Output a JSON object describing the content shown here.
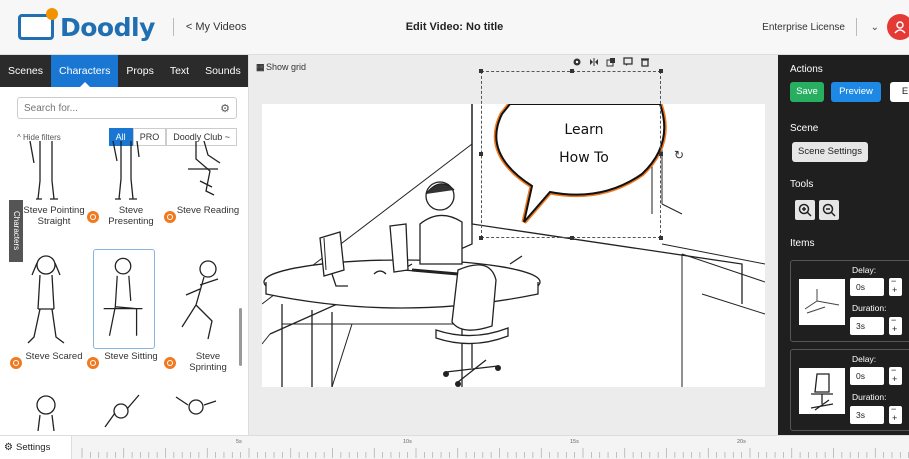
{
  "header": {
    "brand": "Doodly",
    "back_link": "< My Videos",
    "title": "Edit Video: No title",
    "license": "Enterprise License"
  },
  "left_panel": {
    "tabs": [
      "Scenes",
      "Characters",
      "Props",
      "Text",
      "Sounds"
    ],
    "active_tab": "Characters",
    "search_placeholder": "Search for...",
    "hide_filters": "^ Hide filters",
    "filters": [
      "All",
      "PRO",
      "Doodly Club ~"
    ],
    "active_filter": "All",
    "vertical_tab": "Characters",
    "characters": [
      {
        "name": "Steve Pointing Straight"
      },
      {
        "name": "Steve Presenting"
      },
      {
        "name": "Steve Reading"
      },
      {
        "name": "Steve Scared"
      },
      {
        "name": "Steve Sitting"
      },
      {
        "name": "Steve Sprinting"
      }
    ]
  },
  "canvas": {
    "show_grid": "Show grid",
    "speech_line1": "Learn",
    "speech_line2": "How To"
  },
  "right_panel": {
    "actions_heading": "Actions",
    "save": "Save",
    "preview": "Preview",
    "export_partial": "E",
    "scene_heading": "Scene",
    "scene_settings": "Scene Settings",
    "tools_heading": "Tools",
    "items_heading": "Items",
    "items": [
      {
        "delay_label": "Delay:",
        "delay": "0s",
        "duration_label": "Duration:",
        "duration": "3s"
      },
      {
        "delay_label": "Delay:",
        "delay": "0s",
        "duration_label": "Duration:",
        "duration": "3s"
      }
    ]
  },
  "bottom": {
    "settings": "Settings",
    "timeline_labels": [
      "5s",
      "10s",
      "15s",
      "20s"
    ]
  },
  "colors": {
    "brand_blue": "#1f6fb2",
    "accent_orange": "#f07a20",
    "save_green": "#27ae60",
    "preview_blue": "#1e88e5",
    "user_red": "#e53935"
  }
}
